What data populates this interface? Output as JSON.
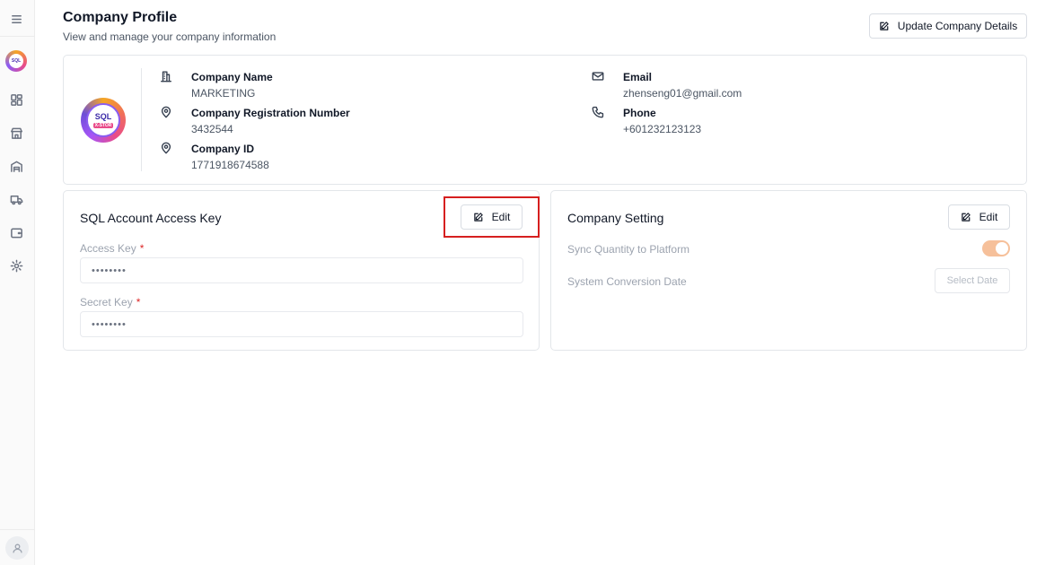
{
  "page": {
    "title": "Company Profile",
    "subtitle": "View and manage your company information",
    "update_button": "Update Company Details"
  },
  "sidebar": {
    "logo_text": "SQL",
    "items": [
      {
        "icon": "dashboard-icon"
      },
      {
        "icon": "store-icon"
      },
      {
        "icon": "warehouse-icon"
      },
      {
        "icon": "truck-icon"
      },
      {
        "icon": "wallet-icon"
      },
      {
        "icon": "gear-icon"
      }
    ]
  },
  "profile": {
    "logo_main": "SQL",
    "logo_sub": "X-STOR",
    "company_name_label": "Company Name",
    "company_name": "MARKETING",
    "reg_label": "Company Registration Number",
    "reg_number": "3432544",
    "id_label": "Company ID",
    "company_id": "1771918674588",
    "email_label": "Email",
    "email": "zhenseng01@gmail.com",
    "phone_label": "Phone",
    "phone": "+601232123123"
  },
  "sql_access": {
    "title": "SQL Account Access Key",
    "edit_label": "Edit",
    "access_key_label": "Access Key",
    "access_key_value": "••••••••",
    "secret_key_label": "Secret Key",
    "secret_key_value": "••••••••",
    "required_mark": "*"
  },
  "company_setting": {
    "title": "Company Setting",
    "edit_label": "Edit",
    "sync_label": "Sync Quantity to Platform",
    "sync_enabled": true,
    "conversion_label": "System Conversion Date",
    "select_date_label": "Select Date"
  },
  "colors": {
    "toggle_on": "#f6c09a",
    "highlight": "#d61f1f",
    "required": "#dc2626"
  }
}
